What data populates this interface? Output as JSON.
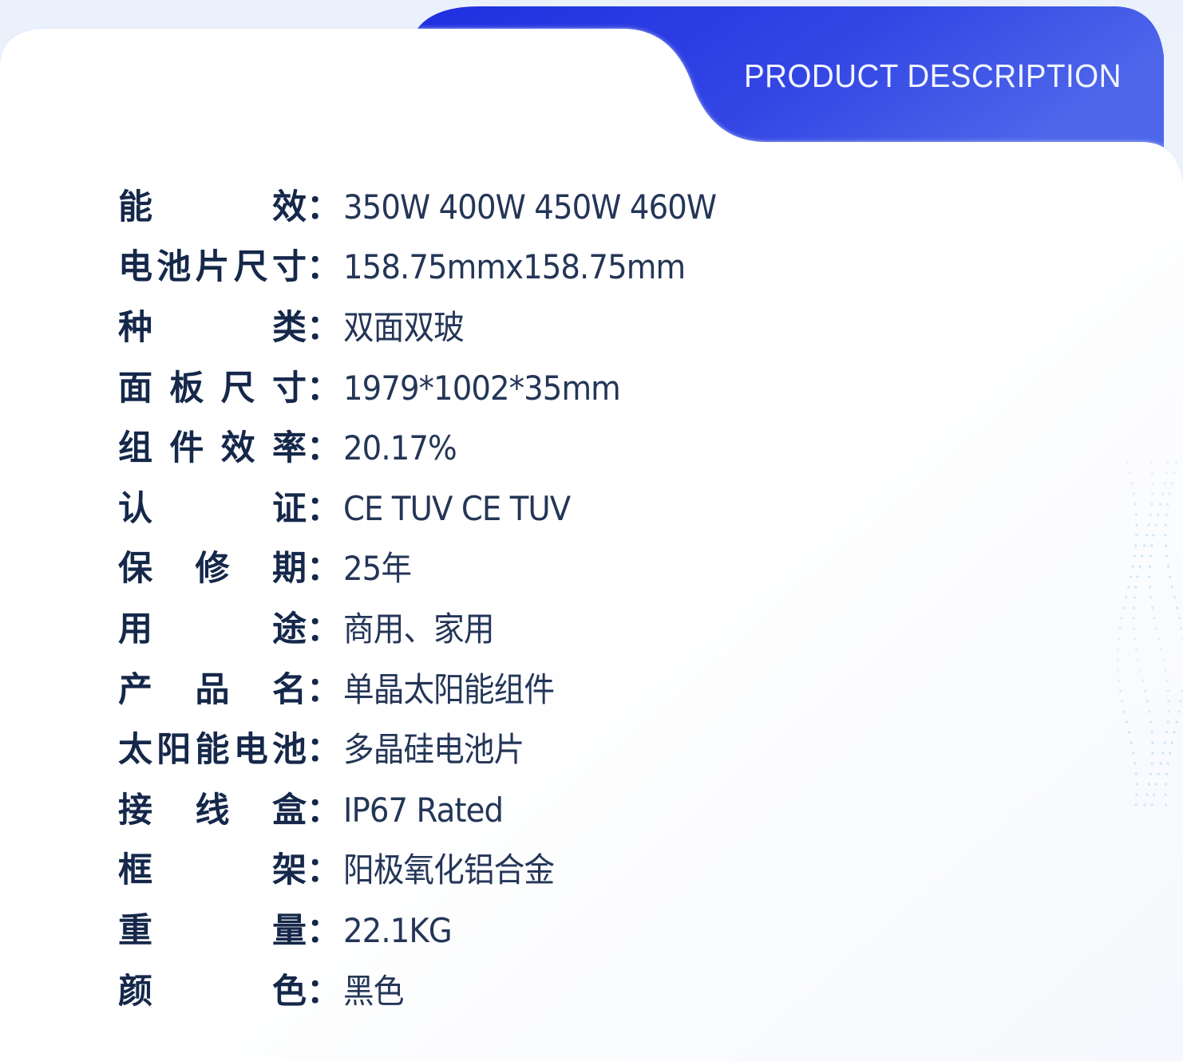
{
  "header": {
    "title": "PRODUCT DESCRIPTION",
    "accent_color": "#2633e0",
    "accent_color_light": "#4c64e8"
  },
  "specs": [
    {
      "label": "能效",
      "value": "350W 400W 450W 460W"
    },
    {
      "label": "电池片尺寸",
      "value": "158.75mmx158.75mm"
    },
    {
      "label": "种类",
      "value": "双面双玻"
    },
    {
      "label": "面板尺寸",
      "value": "1979*1002*35mm"
    },
    {
      "label": "组件效率",
      "value": "20.17%"
    },
    {
      "label": "认证",
      "value": " CE TUV CE TUV"
    },
    {
      "label": "保修期",
      "value": "25年"
    },
    {
      "label": "用途",
      "value": "商用、家用"
    },
    {
      "label": "产品名",
      "value": "单晶太阳能组件"
    },
    {
      "label": "太阳能电池",
      "value": "多晶硅电池片"
    },
    {
      "label": "接线盒",
      "value": "IP67 Rated"
    },
    {
      "label": "框架",
      "value": "阳极氧化铝合金"
    },
    {
      "label": "重量",
      "value": "22.1KG"
    },
    {
      "label": "颜色",
      "value": "黑色"
    }
  ],
  "separator": "："
}
